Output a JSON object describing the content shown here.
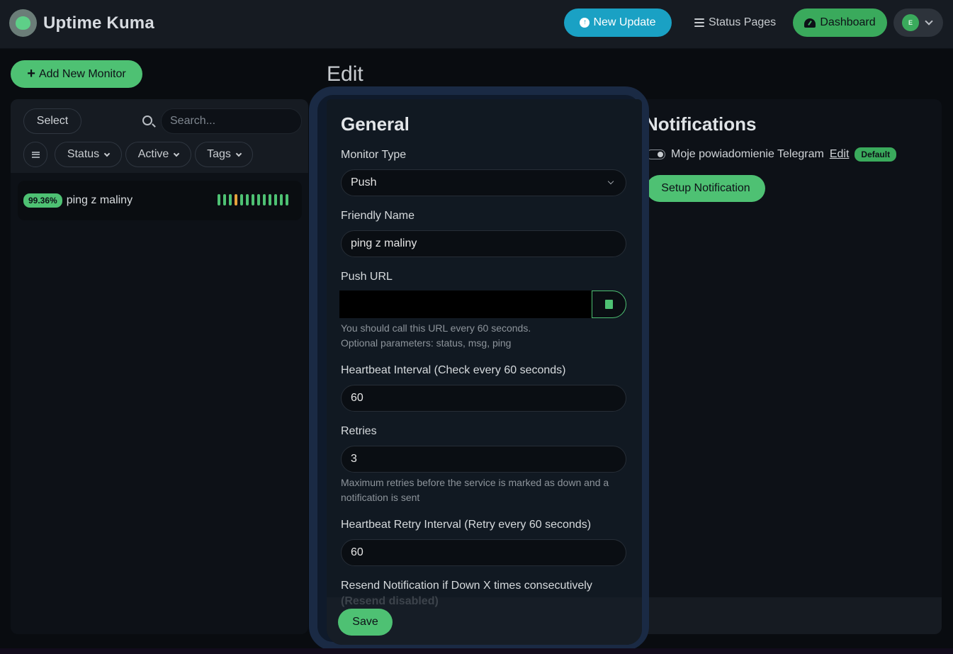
{
  "app": {
    "title": "Uptime Kuma"
  },
  "header": {
    "new_update": "New Update",
    "status_pages": "Status Pages",
    "dashboard": "Dashboard",
    "avatar_initial": "E"
  },
  "sidebar": {
    "add_button": "Add New Monitor",
    "select_button": "Select",
    "search_placeholder": "Search...",
    "filters": {
      "status": "Status",
      "active": "Active",
      "tags": "Tags"
    },
    "monitors": [
      {
        "uptime": "99.36%",
        "name": "ping z maliny",
        "beats": [
          "up",
          "up",
          "up",
          "pending",
          "up",
          "up",
          "up",
          "up",
          "up",
          "up",
          "up",
          "up",
          "up"
        ]
      }
    ]
  },
  "page": {
    "title": "Edit"
  },
  "general": {
    "title": "General",
    "monitor_type_label": "Monitor Type",
    "monitor_type_value": "Push",
    "friendly_name_label": "Friendly Name",
    "friendly_name_value": "ping z maliny",
    "push_url_label": "Push URL",
    "push_url_hint_1": "You should call this URL every 60 seconds.",
    "push_url_hint_2": "Optional parameters: status, msg, ping",
    "heartbeat_label": "Heartbeat Interval (Check every 60 seconds)",
    "heartbeat_value": "60",
    "retries_label": "Retries",
    "retries_value": "3",
    "retries_hint": "Maximum retries before the service is marked as down and a notification is sent",
    "retry_interval_label": "Heartbeat Retry Interval (Retry every 60 seconds)",
    "retry_interval_value": "60",
    "resend_label": "Resend Notification if Down X times consecutively",
    "resend_faded": "(Resend disabled)",
    "save_button": "Save"
  },
  "notifications": {
    "title": "Notifications",
    "items": [
      {
        "name": "Moje powiadomienie Telegram",
        "edit": "Edit",
        "badge": "Default",
        "enabled": true
      }
    ],
    "setup_button": "Setup Notification"
  },
  "colors": {
    "accent": "#4ec173",
    "update": "#1aa1c4",
    "beat_up": "#4ec173",
    "beat_pending": "#e6a23c"
  }
}
